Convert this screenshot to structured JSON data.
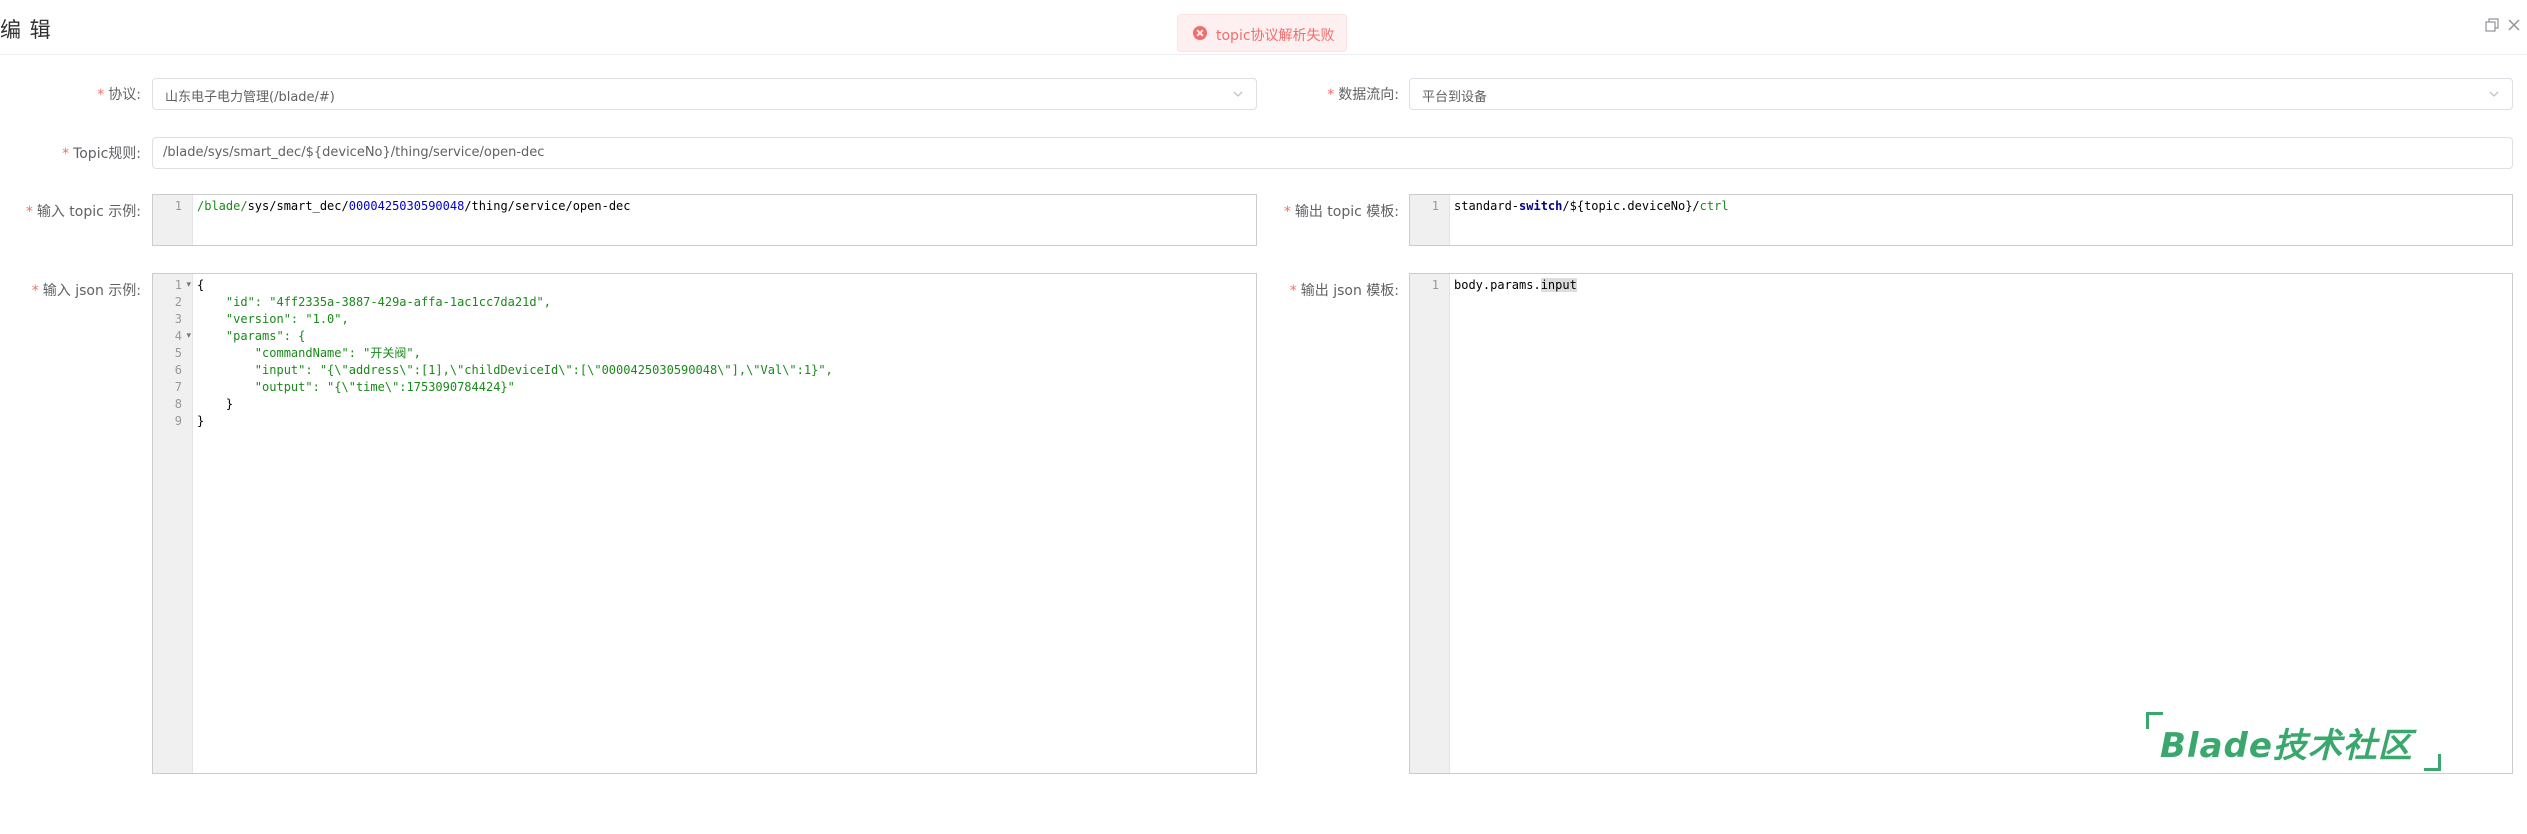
{
  "dialog": {
    "title": "编 辑"
  },
  "toast": {
    "message": "topic协议解析失败",
    "icon": "error-circle-icon",
    "color": "#f56c6c"
  },
  "form": {
    "protocol": {
      "label": "协议:",
      "value": "山东电子电力管理(/blade/#)"
    },
    "data_direction": {
      "label": "数据流向:",
      "value": "平台到设备"
    },
    "topic_rule": {
      "label": "Topic规则:",
      "value": "/blade/sys/smart_dec/${deviceNo}/thing/service/open-dec"
    },
    "input_topic_example": {
      "label": "输入 topic 示例:",
      "lines": [
        "/blade/sys/smart_dec/0000425030590048/thing/service/open-dec"
      ]
    },
    "output_topic_template": {
      "label": "输出 topic 模板:",
      "lines": [
        "standard-switch/${topic.deviceNo}/ctrl"
      ]
    },
    "input_json_example": {
      "label": "输入 json 示例:",
      "lines": [
        "{",
        "    \"id\": \"4ff2335a-3887-429a-affa-1ac1cc7da21d\",",
        "    \"version\": \"1.0\",",
        "    \"params\": {",
        "        \"commandName\": \"开关阀\",",
        "        \"input\": \"{\\\"address\\\":[1],\\\"childDeviceId\\\":[\\\"0000425030590048\\\"],\\\"Val\\\":1}\",",
        "        \"output\": \"{\\\"time\\\":1753090784424}\"",
        "    }",
        "}"
      ]
    },
    "output_json_template": {
      "label": "输出 json 模板:",
      "lines": [
        "body.params.input"
      ]
    }
  },
  "watermark": {
    "text": "Blade技术社区",
    "color": "#3aa76d"
  }
}
